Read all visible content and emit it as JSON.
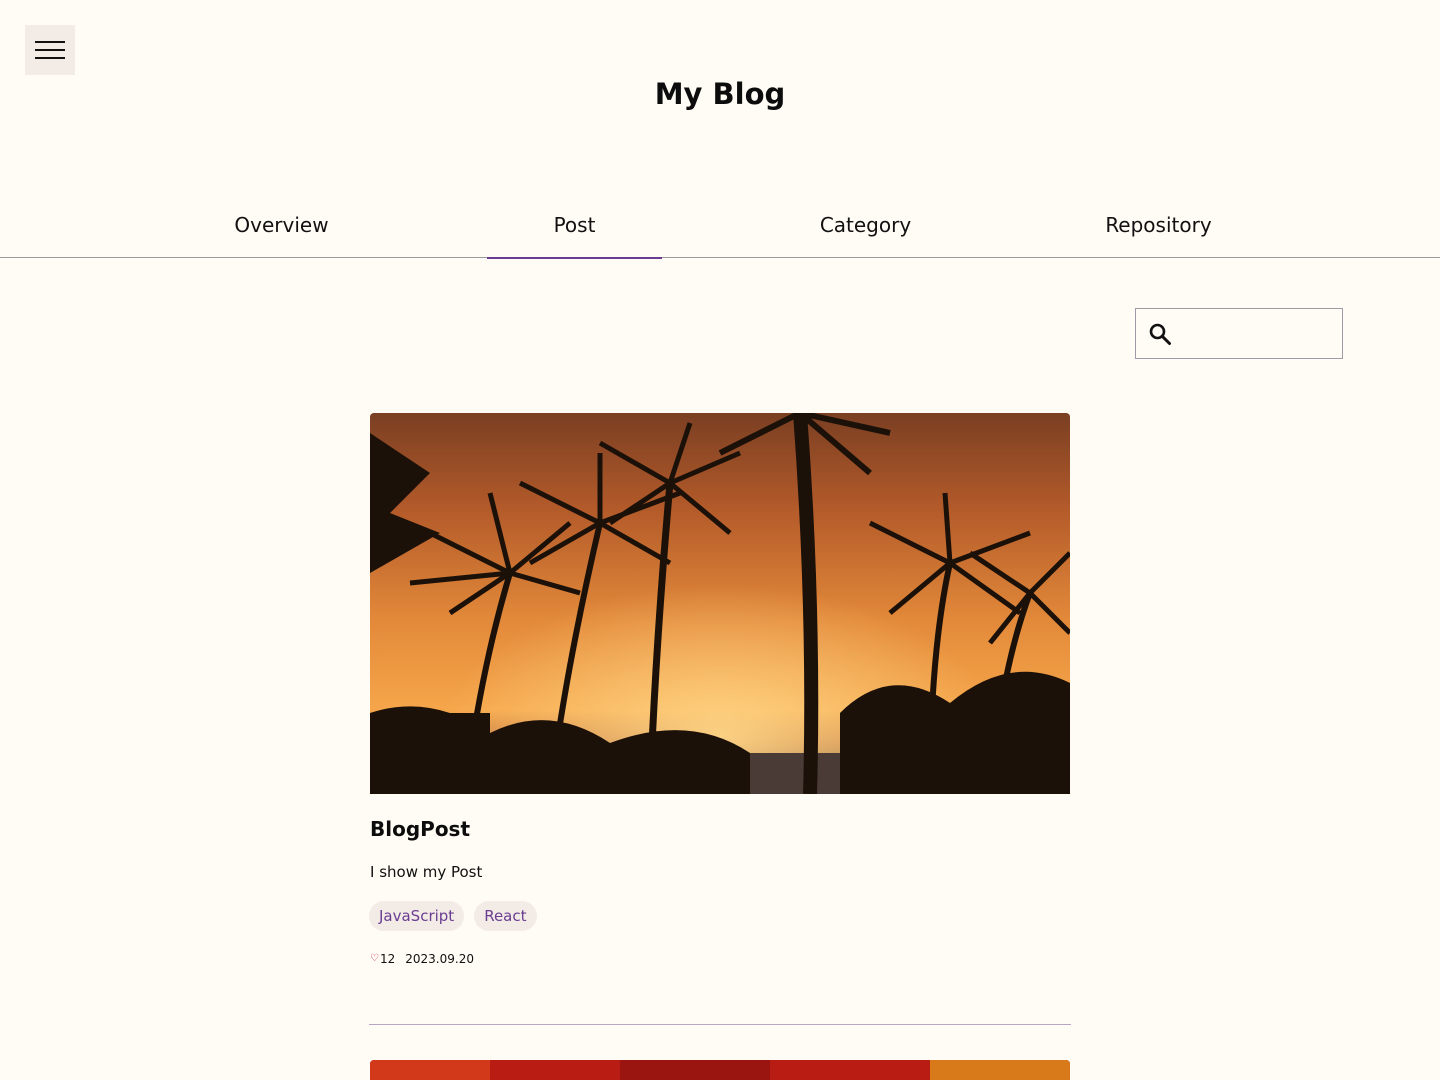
{
  "site": {
    "title": "My Blog"
  },
  "menu": {
    "icon": "hamburger-menu-icon"
  },
  "tabs": [
    {
      "label": "Overview",
      "active": false
    },
    {
      "label": "Post",
      "active": true
    },
    {
      "label": "Category",
      "active": false
    },
    {
      "label": "Repository",
      "active": false
    }
  ],
  "search": {
    "icon": "search-icon",
    "value": "",
    "placeholder": ""
  },
  "posts": [
    {
      "title": "BlogPost",
      "description": "I show my Post",
      "tags": [
        "JavaScript",
        "React"
      ],
      "likes": "12",
      "date": "2023.09.20",
      "like_icon": "heart-icon"
    }
  ],
  "colors": {
    "background": "#fffbf5",
    "accent": "#6a3d92",
    "tag_background": "#f3ebe6",
    "heart": "#c0182a"
  }
}
